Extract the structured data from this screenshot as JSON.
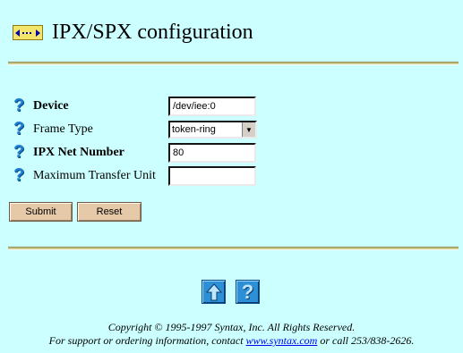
{
  "header": {
    "title": "IPX/SPX configuration",
    "icon": "network-arrows-icon"
  },
  "form": {
    "fields": [
      {
        "label": "Device",
        "value": "/dev/iee:0",
        "bold": true
      },
      {
        "label": "Frame Type",
        "value": "token-ring",
        "bold": false
      },
      {
        "label": "IPX Net Number",
        "value": "80",
        "bold": true
      },
      {
        "label": "Maximum Transfer Unit",
        "value": "",
        "bold": false
      }
    ],
    "submit_label": "Submit",
    "reset_label": "Reset"
  },
  "footer": {
    "copyright": "Copyright © 1995-1997 Syntax, Inc. All Rights Reserved.",
    "support_prefix": "For support or ordering information, contact ",
    "support_link": "www.syntax.com",
    "support_suffix": " or call 253/838-2626."
  },
  "colors": {
    "background": "#ccffff",
    "button": "#e6c9a8",
    "accent": "#1e7fd0"
  }
}
